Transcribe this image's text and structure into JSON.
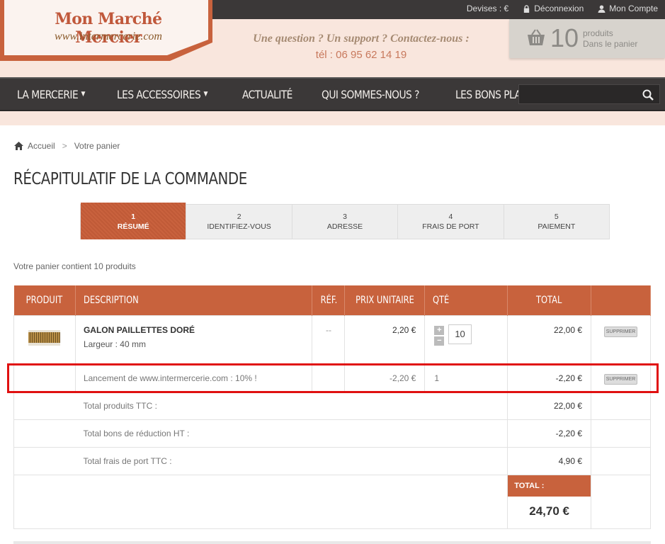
{
  "header": {
    "logo_title": "Mon Marché Mercier",
    "logo_url": "www.intermercerie.com",
    "contact_line": "Une question ? Un support ? Contactez-nous :",
    "contact_phone": "tél : 06 95 62 14 19",
    "top_links": {
      "currency": "Devises : €",
      "logout": "Déconnexion",
      "account": "Mon Compte"
    },
    "cart": {
      "count": "10",
      "label1": "produits",
      "label2": "Dans le panier"
    }
  },
  "menu": {
    "items": [
      {
        "label": "LA MERCERIE",
        "dropdown": true
      },
      {
        "label": "LES ACCESSOIRES",
        "dropdown": true
      },
      {
        "label": "ACTUALITÉ",
        "dropdown": false
      },
      {
        "label": "QUI SOMMES-NOUS ?",
        "dropdown": false
      },
      {
        "label": "LES BONS PLANS",
        "dropdown": false
      }
    ],
    "search_placeholder": ""
  },
  "breadcrumb": {
    "home": "Accueil",
    "separator": ">",
    "current": "Votre panier"
  },
  "page_title": "RÉCAPITULATIF DE LA COMMANDE",
  "steps": [
    {
      "num": "1",
      "label": "RÉSUMÉ",
      "active": true
    },
    {
      "num": "2",
      "label": "IDENTIFIEZ-VOUS",
      "active": false
    },
    {
      "num": "3",
      "label": "ADRESSE",
      "active": false
    },
    {
      "num": "4",
      "label": "FRAIS DE PORT",
      "active": false
    },
    {
      "num": "5",
      "label": "PAIEMENT",
      "active": false
    }
  ],
  "cart_summary_text": "Votre panier contient 10 produits",
  "table": {
    "headers": {
      "product": "PRODUIT",
      "description": "DESCRIPTION",
      "ref": "RÉF.",
      "unit_price": "PRIX UNITAIRE",
      "qty": "QTÉ",
      "total": "TOTAL"
    },
    "product_row": {
      "name": "GALON PAILLETTES DORÉ",
      "attr": "Largeur : 40 mm",
      "ref": "--",
      "unit_price": "2,20 €",
      "qty": "10",
      "qty_plus": "+",
      "qty_minus": "−",
      "total": "22,00 €",
      "delete": "SUPPRIMER"
    },
    "discount_row": {
      "description": "Lancement de www.intermercerie.com : 10% !",
      "unit_price": "-2,20 €",
      "qty": "1",
      "total": "-2,20 €",
      "delete": "SUPPRIMER"
    },
    "totals": {
      "products_label": "Total produits TTC :",
      "products_value": "22,00 €",
      "vouchers_label": "Total bons de réduction HT :",
      "vouchers_value": "-2,20 €",
      "shipping_label": "Total frais de port TTC :",
      "shipping_value": "4,90 €",
      "grand_label": "TOTAL :",
      "grand_value": "24,70 €"
    }
  },
  "colors": {
    "accent": "#c8623d",
    "dark": "#3b3838",
    "highlight": "#e01010",
    "background": "#f9e6dd"
  },
  "icons": {
    "lock": "lock-icon",
    "user": "user-icon",
    "basket": "basket-icon",
    "search": "search-icon",
    "home": "home-icon"
  }
}
